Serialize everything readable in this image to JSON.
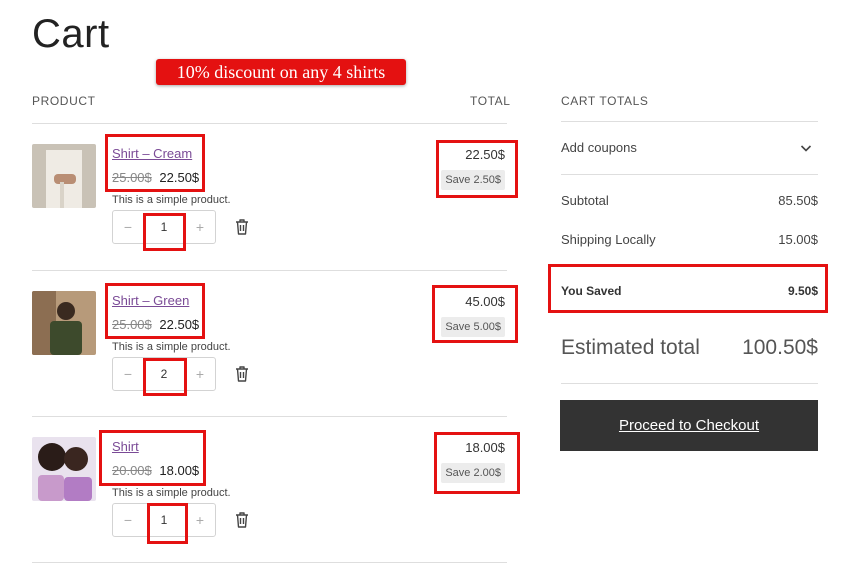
{
  "page": {
    "title": "Cart"
  },
  "promo": {
    "text": "10% discount on any 4 shirts",
    "color": "#e41111"
  },
  "table": {
    "col_product": "PRODUCT",
    "col_total": "TOTAL"
  },
  "items": [
    {
      "name": "Shirt – Cream",
      "old_price": "25.00$",
      "price": "22.50$",
      "description": "This is a simple product.",
      "quantity": "1",
      "total": "22.50$",
      "save": "Save 2.50$",
      "minus": "−",
      "plus": "+"
    },
    {
      "name": "Shirt – Green",
      "old_price": "25.00$",
      "price": "22.50$",
      "description": "This is a simple product.",
      "quantity": "2",
      "total": "45.00$",
      "save": "Save 5.00$",
      "minus": "−",
      "plus": "+"
    },
    {
      "name": "Shirt",
      "old_price": "20.00$",
      "price": "18.00$",
      "description": "This is a simple product.",
      "quantity": "1",
      "total": "18.00$",
      "save": "Save 2.00$",
      "minus": "−",
      "plus": "+"
    }
  ],
  "totals": {
    "heading": "CART TOTALS",
    "coupons_label": "Add coupons",
    "subtotal_label": "Subtotal",
    "subtotal_value": "85.50$",
    "shipping_label": "Shipping Locally",
    "shipping_value": "15.00$",
    "saved_label": "You Saved",
    "saved_value": "9.50$",
    "estimated_label": "Estimated total",
    "estimated_value": "100.50$",
    "checkout_label": "Proceed to Checkout"
  },
  "icons": {
    "trash": "trash-icon",
    "chevron": "chevron-down-icon"
  },
  "colors": {
    "link": "#7a4a96",
    "button": "#333333",
    "highlight": "#e41111"
  }
}
